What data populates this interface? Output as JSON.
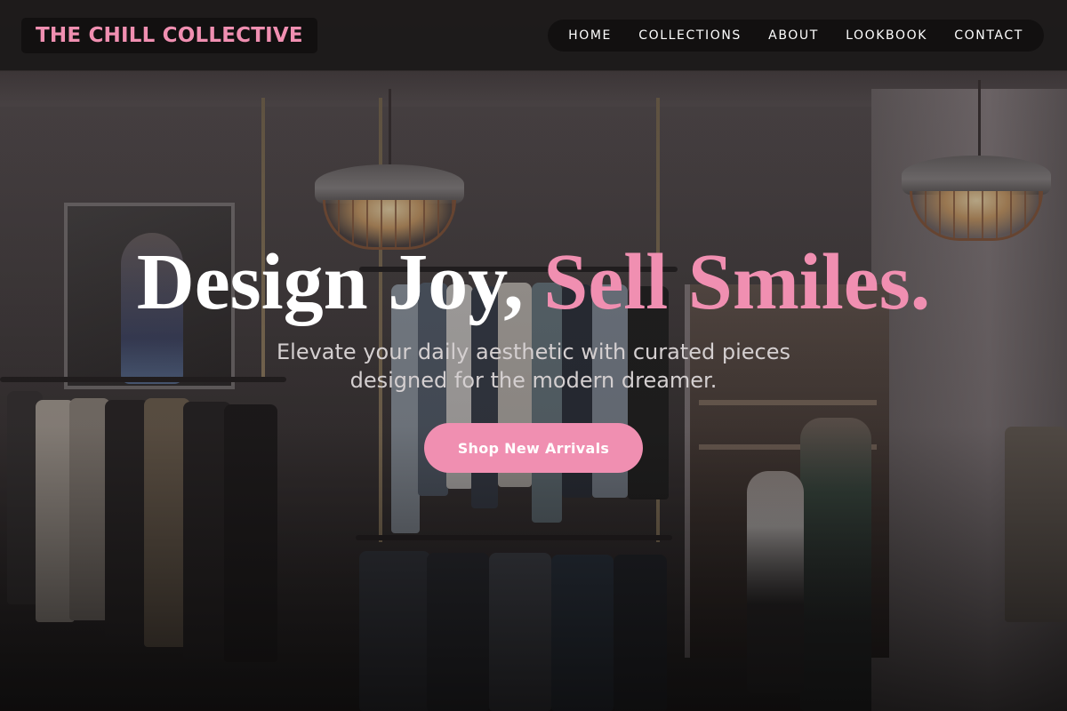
{
  "brand": {
    "name": "THE CHILL COLLECTIVE",
    "accent_color": "#f08fb1"
  },
  "nav": {
    "items": [
      {
        "label": "HOME"
      },
      {
        "label": "COLLECTIONS"
      },
      {
        "label": "ABOUT"
      },
      {
        "label": "LOOKBOOK"
      },
      {
        "label": "CONTACT"
      }
    ]
  },
  "hero": {
    "title_main": "Design Joy,",
    "title_accent": "Sell Smiles.",
    "subtitle": "Elevate your daily aesthetic with curated pieces designed for the modern dreamer.",
    "cta_label": "Shop New Arrivals",
    "background_image": "clothing-store-interior"
  }
}
